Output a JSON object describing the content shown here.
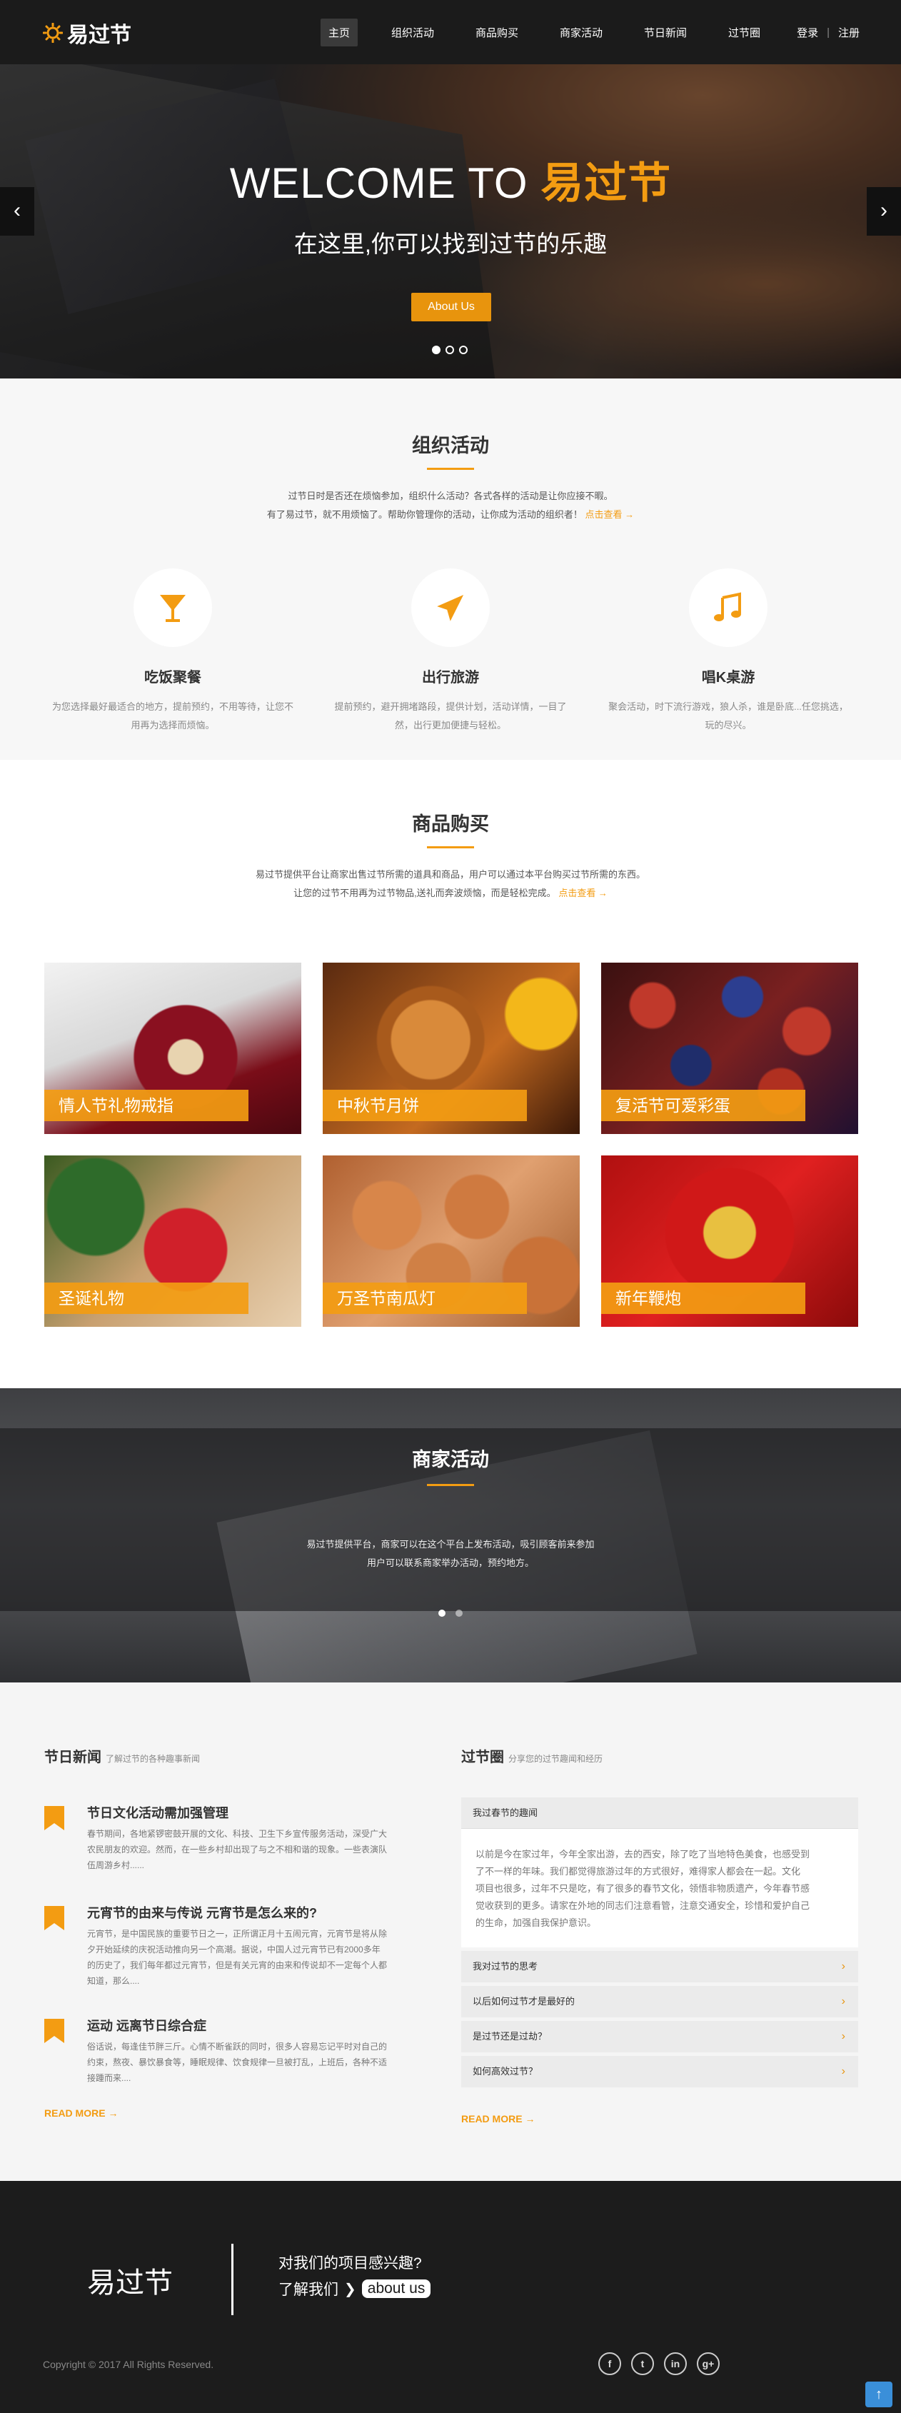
{
  "nav": {
    "logo": "易过节",
    "items": [
      "主页",
      "组织活动",
      "商品购买",
      "商家活动",
      "节日新闻",
      "过节圈"
    ],
    "login": "登录",
    "register": "注册"
  },
  "hero": {
    "title_prefix": "WELCOME TO ",
    "title_accent": "易过节",
    "subtitle": "在这里,你可以找到过节的乐趣",
    "button": "About Us",
    "prev": "‹",
    "next": "›"
  },
  "activities": {
    "title": "组织活动",
    "desc_line1": "过节日时是否还在烦恼参加，组织什么活动？各式各样的活动是让你应接不暇。",
    "desc_line2": "有了易过节，就不用烦恼了。帮助你管理你的活动，让你成为活动的组织者！",
    "more": "点击查看 →",
    "features": [
      {
        "icon": "cocktail-icon",
        "title": "吃饭聚餐",
        "text": "为您选择最好最适合的地方，提前预约，不用等待，让您不用再为选择而烦恼。"
      },
      {
        "icon": "airplane-icon",
        "title": "出行旅游",
        "text": "提前预约，避开拥堵路段，提供计划，活动详情，一目了然，出行更加便捷与轻松。"
      },
      {
        "icon": "music-note-icon",
        "title": "唱K桌游",
        "text": "聚会活动，时下流行游戏，狼人杀，谁是卧底...任您挑选，玩的尽兴。"
      }
    ]
  },
  "goods": {
    "title": "商品购买",
    "desc_line1": "易过节提供平台让商家出售过节所需的道具和商品，用户可以通过本平台购买过节所需的东西。",
    "desc_line2": "让您的过节不用再为过节物品,送礼而奔波烦恼，而是轻松完成。",
    "more": "点击查看 →",
    "tiles": [
      "情人节礼物戒指",
      "中秋节月饼",
      "复活节可爱彩蛋",
      "圣诞礼物",
      "万圣节南瓜灯",
      "新年鞭炮"
    ]
  },
  "merchant": {
    "title": "商家活动",
    "desc_line1": "易过节提供平台，商家可以在这个平台上发布活动，吸引顾客前来参加",
    "desc_line2": "用户可以联系商家举办活动，预约地方。"
  },
  "news": {
    "title": "节日新闻",
    "subtitle": "了解过节的各种趣事新闻",
    "items": [
      {
        "title": "节日文化活动需加强管理",
        "line1": "春节期间，各地紧锣密鼓开展的文化、科技、卫生下乡宣传服务活动，深受广大",
        "line2": "农民朋友的欢迎。然而，在一些乡村却出现了与之不相和谐的现象。一些表演队",
        "line3": "伍周游乡村......"
      },
      {
        "title": "元宵节的由来与传说 元宵节是怎么来的?",
        "line1": "元宵节，是中国民族的重要节日之一，正所谓正月十五闹元宵，元宵节是将从除",
        "line2": "夕开始延续的庆祝活动推向另一个高潮。据说，中国人过元宵节已有2000多年",
        "line3": "的历史了，我们每年都过元宵节，但是有关元宵的由来和传说却不一定每个人都",
        "line4": "知道，那么...."
      },
      {
        "title": "运动 远离节日综合症",
        "line1": "俗话说，每逢佳节胖三斤。心情不断雀跃的同时，很多人容易忘记平时对自己的",
        "line2": "约束，熬夜、暴饮暴食等，睡眠规律、饮食规律一旦被打乱，上班后，各种不适",
        "line3": "接踵而来...."
      }
    ],
    "readmore": "READ MORE →"
  },
  "circle": {
    "title": "过节圈",
    "subtitle": "分享您的过节趣闻和经历",
    "open_title": "我过春节的趣闻",
    "open_line1": "以前是今在家过年，今年全家出游，去的西安，除了吃了当地特色美食，也感受到",
    "open_line2": "了不一样的年味。我们都觉得旅游过年的方式很好，难得家人都会在一起。文化",
    "open_line3": "项目也很多，过年不只是吃，有了很多的春节文化，领悟非物质遗产，今年春节感",
    "open_line4": "觉收获到的更多。请家在外地的同志们注意看管，注意交通安全，珍惜和爱护自己",
    "open_line5": "的生命，加强自我保护意识。",
    "items": [
      "我对过节的思考",
      "以后如何过节才是最好的",
      "是过节还是过劫？",
      "如何高效过节？"
    ],
    "readmore": "READ MORE →"
  },
  "footer": {
    "logo": "易过节",
    "question": "对我们的项目感兴趣?",
    "learn": "了解我们",
    "about": "about us",
    "copyright": "Copyright © 2017 All Rights Reserved.",
    "social": [
      "f",
      "t",
      "in",
      "g+"
    ]
  },
  "colors": {
    "accent": "#f39c12",
    "nav": "#1b1b1b",
    "footer": "#1c1c1c"
  }
}
